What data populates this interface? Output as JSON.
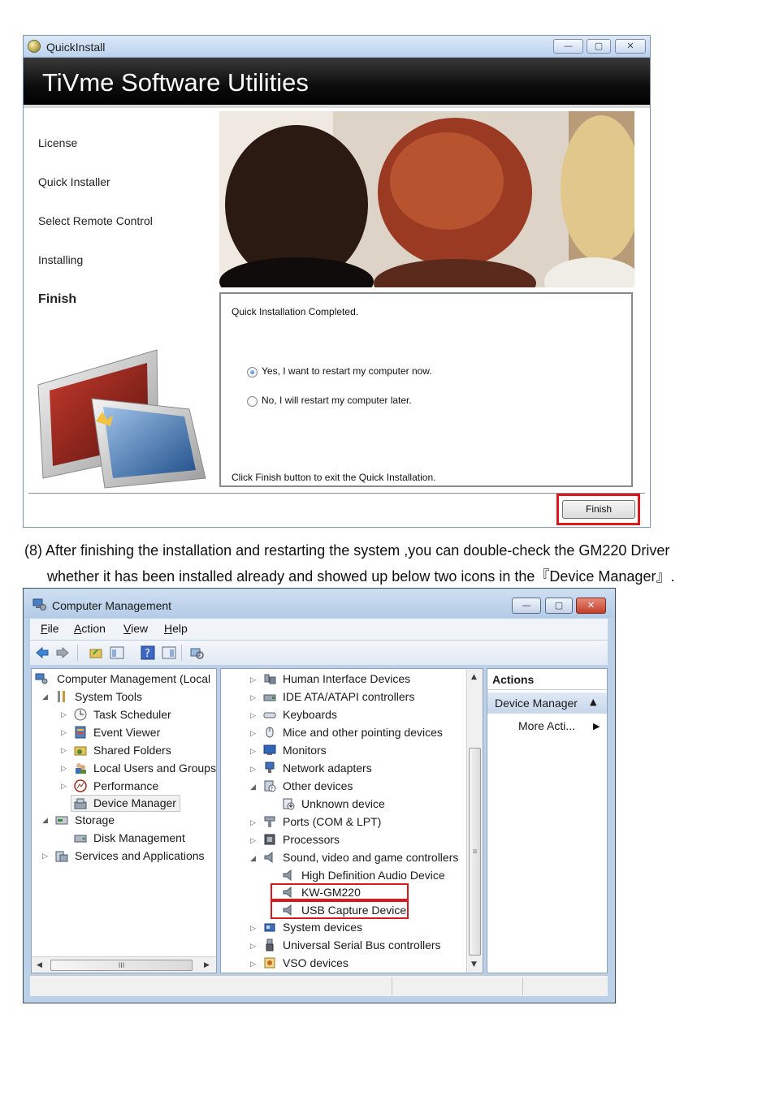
{
  "quickinstall": {
    "window_title": "QuickInstall",
    "controls": {
      "minimize": "—",
      "maximize": "▢",
      "close": "✕"
    },
    "banner_title": "TiVme Software Utilities",
    "steps": [
      {
        "label": "License"
      },
      {
        "label": "Quick Installer"
      },
      {
        "label": "Select Remote Control"
      },
      {
        "label": "Installing"
      },
      {
        "label": "Finish",
        "active": true
      }
    ],
    "panel": {
      "heading": "Quick Installation Completed.",
      "options": [
        {
          "label": "Yes, I want to restart my computer now.",
          "selected": true
        },
        {
          "label": "No, I will restart my computer later.",
          "selected": false
        }
      ],
      "footer": "Click Finish button to exit the Quick Installation."
    },
    "finish_button": "Finish",
    "highlight_color": "#d9191c"
  },
  "instruction": {
    "line1": "(8) After finishing the installation and restarting the system ,you can double-check the GM220 Driver",
    "line2": "whether it has been installed already and showed up below two icons in the『Device Manager』."
  },
  "computer_management": {
    "window_title": "Computer Management",
    "menu": [
      {
        "key": "F",
        "rest": "ile"
      },
      {
        "key": "A",
        "rest": "ction"
      },
      {
        "key": "V",
        "rest": "iew"
      },
      {
        "key": "H",
        "rest": "elp"
      }
    ],
    "left_tree": {
      "root": "Computer Management (Local",
      "system_tools": "System Tools",
      "task_scheduler": "Task Scheduler",
      "event_viewer": "Event Viewer",
      "shared_folders": "Shared Folders",
      "local_users": "Local Users and Groups",
      "performance": "Performance",
      "device_manager": "Device Manager",
      "storage": "Storage",
      "disk_management": "Disk Management",
      "services": "Services and Applications",
      "scroll_grip": "III"
    },
    "devices": {
      "hid": "Human Interface Devices",
      "ide": "IDE ATA/ATAPI controllers",
      "keyboards": "Keyboards",
      "mice": "Mice and other pointing devices",
      "monitors": "Monitors",
      "network": "Network adapters",
      "other": "Other devices",
      "unknown": "Unknown device",
      "ports": "Ports (COM & LPT)",
      "processors": "Processors",
      "sound": "Sound, video and game controllers",
      "hd_audio": "High Definition Audio Device",
      "kw_gm220": "KW-GM220",
      "usb_capture": "USB Capture Device",
      "system": "System devices",
      "usb_ctrl": "Universal Serial Bus controllers",
      "vso": "VSO devices",
      "scroll_grip": "≡"
    },
    "actions": {
      "header": "Actions",
      "section": "Device Manager",
      "more": "More Acti..."
    },
    "highlight_color": "#d9191c"
  }
}
